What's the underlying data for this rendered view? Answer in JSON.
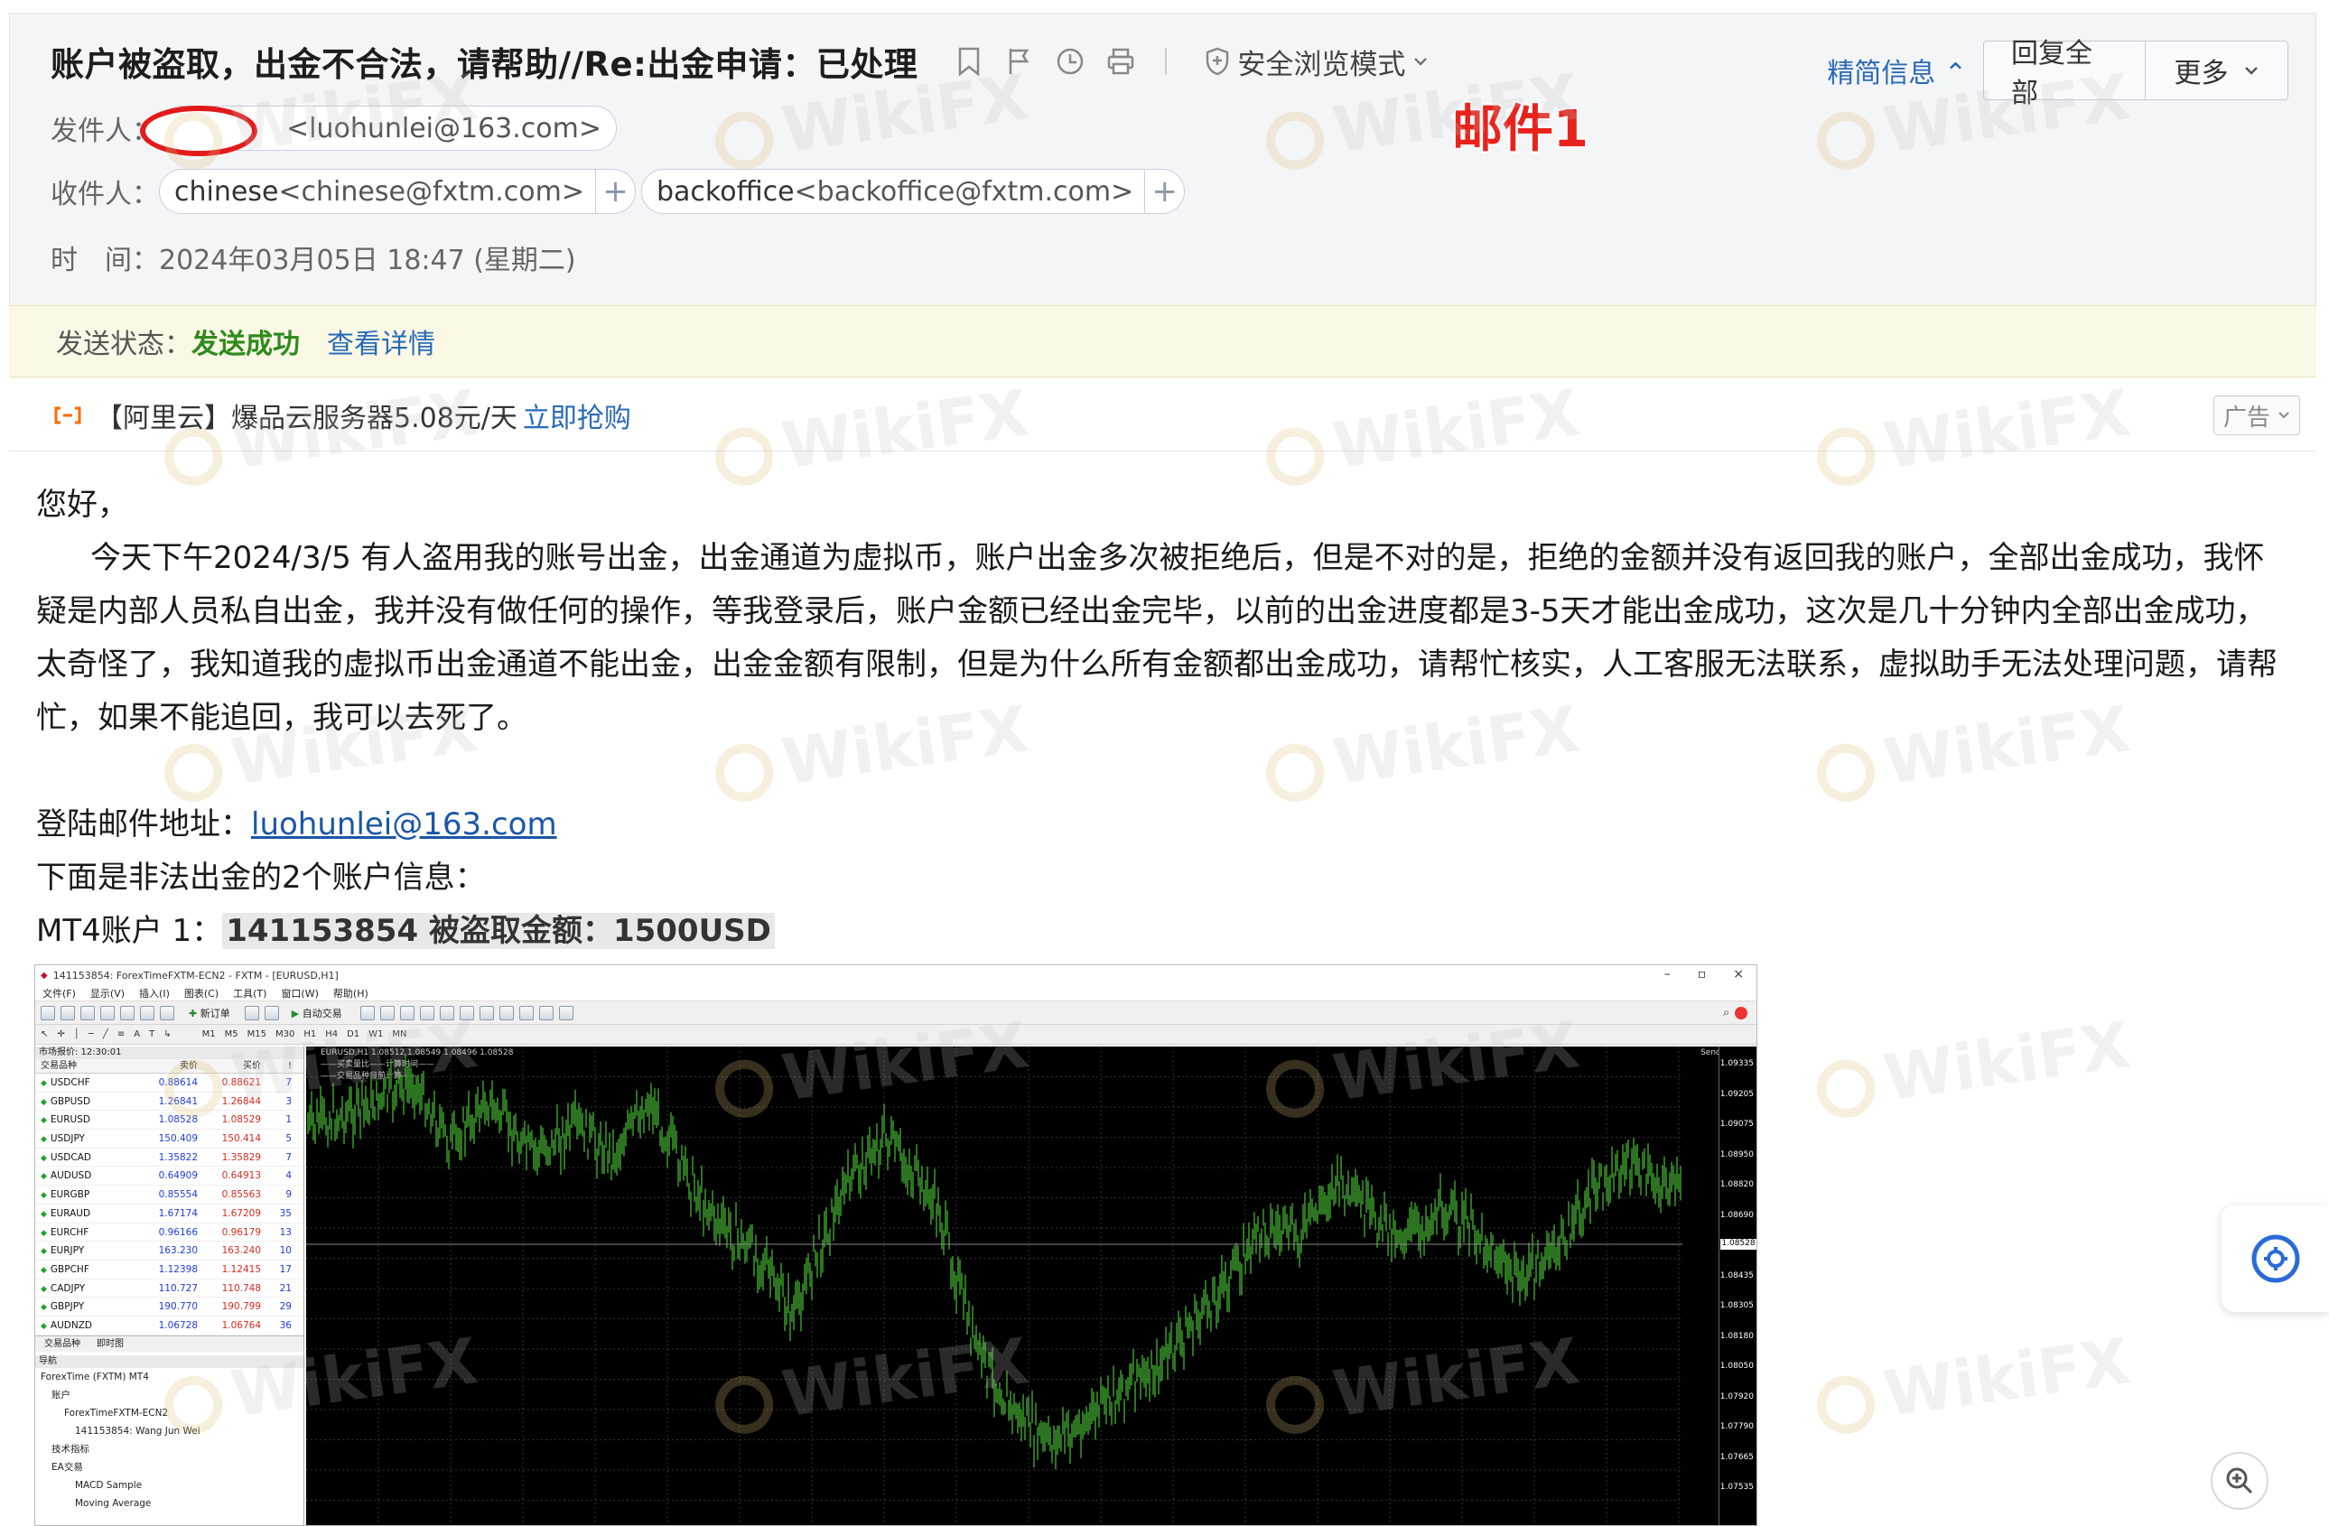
{
  "header": {
    "subject": "账户被盗取，出金不合法，请帮助//Re:出金申请：已处理",
    "safe_mode": "安全浏览模式",
    "simple_info": "精简信息",
    "reply_all": "回复全部",
    "more": "更多",
    "from_label": "发件人：",
    "from_addr": "<luohunlei@163.com>",
    "to_label": "收件人：",
    "to": [
      {
        "name": "chinese",
        "addr": "<chinese@fxtm.com>"
      },
      {
        "name": "backoffice",
        "addr": "<backoffice@fxtm.com>"
      }
    ],
    "time_label": "时　间：",
    "time_value": "2024年03月05日 18:47 (星期二)",
    "tag": "邮件1"
  },
  "status": {
    "label": "发送状态：",
    "value": "发送成功",
    "detail_link": "查看详情"
  },
  "ad": {
    "text": "【阿里云】爆品云服务器5.08元/天",
    "link": "立即抢购",
    "close": "广告"
  },
  "body": {
    "greeting": "您好，",
    "para": "今天下午2024/3/5 有人盗用我的账号出金，出金通道为虚拟币，账户出金多次被拒绝后，但是不对的是，拒绝的金额并没有返回我的账户，全部出金成功，我怀疑是内部人员私自出金，我并没有做任何的操作，等我登录后，账户金额已经出金完毕，以前的出金进度都是3-5天才能出金成功，这次是几十分钟内全部出金成功，太奇怪了，我知道我的虚拟币出金通道不能出金，出金金额有限制，但是为什么所有金额都出金成功，请帮忙核实，人工客服无法联系，虚拟助手无法处理问题，请帮忙，如果不能追回，我可以去死了。",
    "login_label": "登陆邮件地址：",
    "login_email": "luohunlei@163.com",
    "accounts_line": "下面是非法出金的2个账户信息：",
    "mt4_label": "MT4账户 1：",
    "mt4_highlight": "141153854  被盗取金额：1500USD"
  },
  "watermark": "WikiFX",
  "mt4": {
    "title": "141153854: ForexTimeFXTM-ECN2 - FXTM - [EURUSD,H1]",
    "menu": [
      "文件(F)",
      "显示(V)",
      "插入(I)",
      "图表(C)",
      "工具(T)",
      "窗口(W)",
      "帮助(H)"
    ],
    "toolbar_labels": {
      "new_order": "新订单",
      "auto_trade": "自动交易"
    },
    "timeframes": [
      "M1",
      "M5",
      "M15",
      "M30",
      "H1",
      "H4",
      "D1",
      "W1",
      "MN"
    ],
    "market_watch_title": "市场报价: 12:30:01",
    "mw_cols": [
      "交易品种",
      "卖价",
      "买价",
      "!"
    ],
    "quotes": [
      [
        "USDCHF",
        "0.88614",
        "0.88621",
        "7"
      ],
      [
        "GBPUSD",
        "1.26841",
        "1.26844",
        "3"
      ],
      [
        "EURUSD",
        "1.08528",
        "1.08529",
        "1"
      ],
      [
        "USDJPY",
        "150.409",
        "150.414",
        "5"
      ],
      [
        "USDCAD",
        "1.35822",
        "1.35829",
        "7"
      ],
      [
        "AUDUSD",
        "0.64909",
        "0.64913",
        "4"
      ],
      [
        "EURGBP",
        "0.85554",
        "0.85563",
        "9"
      ],
      [
        "EURAUD",
        "1.67174",
        "1.67209",
        "35"
      ],
      [
        "EURCHF",
        "0.96166",
        "0.96179",
        "13"
      ],
      [
        "EURJPY",
        "163.230",
        "163.240",
        "10"
      ],
      [
        "GBPCHF",
        "1.12398",
        "1.12415",
        "17"
      ],
      [
        "CADJPY",
        "110.727",
        "110.748",
        "21"
      ],
      [
        "GBPJPY",
        "190.770",
        "190.799",
        "29"
      ],
      [
        "AUDNZD",
        "1.06728",
        "1.06764",
        "36"
      ]
    ],
    "mw_tabs": [
      "交易品种",
      "即时图"
    ],
    "nav_title": "导航",
    "nav_items": [
      "ForexTime (FXTM) MT4",
      "账户",
      "ForexTimeFXTM-ECN2",
      "141153854: Wang Jun Wei",
      "技术指标",
      "EA交易",
      "MACD Sample",
      "Moving Average"
    ],
    "chart_info": "EURUSD,H1  1.08512 1.08549 1.08496 1.08528",
    "chart_sub1": "——买卖量比——计算时间——",
    "chart_sub2": "——交易品种目前计算——",
    "sender": "Sender",
    "price_ticks": [
      "1.09335",
      "1.09205",
      "1.09075",
      "1.08950",
      "1.08820",
      "1.08690",
      "1.08560",
      "1.08435",
      "1.08305",
      "1.08180",
      "1.08050",
      "1.07920",
      "1.07790",
      "1.07665",
      "1.07535"
    ],
    "current_price": "1.08528"
  }
}
